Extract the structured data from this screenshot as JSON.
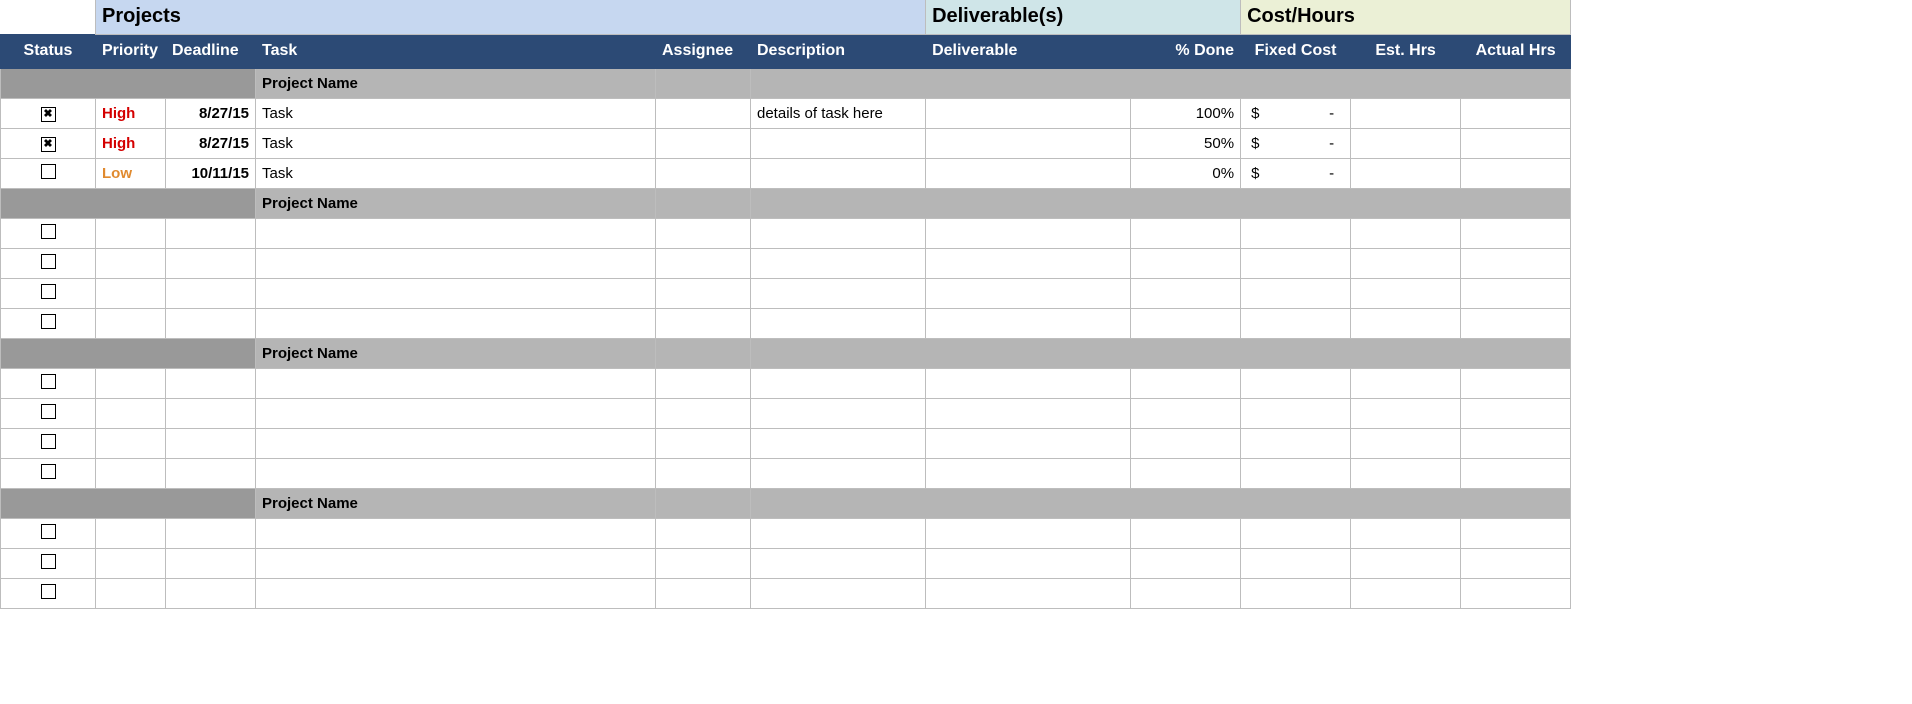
{
  "superheaders": {
    "projects": "Projects",
    "deliverables": "Deliverable(s)",
    "cost": "Cost/Hours"
  },
  "columns": {
    "status": "Status",
    "priority": "Priority",
    "deadline": "Deadline",
    "task": "Task",
    "assignee": "Assignee",
    "description": "Description",
    "deliverable": "Deliverable",
    "pct_done": "% Done",
    "fixed_cost": "Fixed Cost",
    "est_hrs": "Est. Hrs",
    "actual_hrs": "Actual Hrs"
  },
  "groups": [
    {
      "name": "Project Name",
      "tasks": [
        {
          "checked": true,
          "priority": "High",
          "priority_class": "high",
          "deadline": "8/27/15",
          "task": "Task",
          "assignee": "",
          "description": "details of task here",
          "deliverable": "",
          "pct_done": "100%",
          "fixed_cost_sym": "$",
          "fixed_cost_val": "-",
          "est_hrs": "",
          "actual_hrs": ""
        },
        {
          "checked": true,
          "priority": "High",
          "priority_class": "high",
          "deadline": "8/27/15",
          "task": "Task",
          "assignee": "",
          "description": "",
          "deliverable": "",
          "pct_done": "50%",
          "fixed_cost_sym": "$",
          "fixed_cost_val": "-",
          "est_hrs": "",
          "actual_hrs": ""
        },
        {
          "checked": false,
          "priority": "Low",
          "priority_class": "low",
          "deadline": "10/11/15",
          "task": "Task",
          "assignee": "",
          "description": "",
          "deliverable": "",
          "pct_done": "0%",
          "fixed_cost_sym": "$",
          "fixed_cost_val": "-",
          "est_hrs": "",
          "actual_hrs": ""
        }
      ]
    },
    {
      "name": "Project Name",
      "tasks": [
        {
          "checked": false,
          "priority": "",
          "priority_class": "",
          "deadline": "",
          "task": "",
          "assignee": "",
          "description": "",
          "deliverable": "",
          "pct_done": "",
          "fixed_cost_sym": "",
          "fixed_cost_val": "",
          "est_hrs": "",
          "actual_hrs": ""
        },
        {
          "checked": false,
          "priority": "",
          "priority_class": "",
          "deadline": "",
          "task": "",
          "assignee": "",
          "description": "",
          "deliverable": "",
          "pct_done": "",
          "fixed_cost_sym": "",
          "fixed_cost_val": "",
          "est_hrs": "",
          "actual_hrs": ""
        },
        {
          "checked": false,
          "priority": "",
          "priority_class": "",
          "deadline": "",
          "task": "",
          "assignee": "",
          "description": "",
          "deliverable": "",
          "pct_done": "",
          "fixed_cost_sym": "",
          "fixed_cost_val": "",
          "est_hrs": "",
          "actual_hrs": ""
        },
        {
          "checked": false,
          "priority": "",
          "priority_class": "",
          "deadline": "",
          "task": "",
          "assignee": "",
          "description": "",
          "deliverable": "",
          "pct_done": "",
          "fixed_cost_sym": "",
          "fixed_cost_val": "",
          "est_hrs": "",
          "actual_hrs": ""
        }
      ]
    },
    {
      "name": "Project Name",
      "tasks": [
        {
          "checked": false,
          "priority": "",
          "priority_class": "",
          "deadline": "",
          "task": "",
          "assignee": "",
          "description": "",
          "deliverable": "",
          "pct_done": "",
          "fixed_cost_sym": "",
          "fixed_cost_val": "",
          "est_hrs": "",
          "actual_hrs": ""
        },
        {
          "checked": false,
          "priority": "",
          "priority_class": "",
          "deadline": "",
          "task": "",
          "assignee": "",
          "description": "",
          "deliverable": "",
          "pct_done": "",
          "fixed_cost_sym": "",
          "fixed_cost_val": "",
          "est_hrs": "",
          "actual_hrs": ""
        },
        {
          "checked": false,
          "priority": "",
          "priority_class": "",
          "deadline": "",
          "task": "",
          "assignee": "",
          "description": "",
          "deliverable": "",
          "pct_done": "",
          "fixed_cost_sym": "",
          "fixed_cost_val": "",
          "est_hrs": "",
          "actual_hrs": ""
        },
        {
          "checked": false,
          "priority": "",
          "priority_class": "",
          "deadline": "",
          "task": "",
          "assignee": "",
          "description": "",
          "deliverable": "",
          "pct_done": "",
          "fixed_cost_sym": "",
          "fixed_cost_val": "",
          "est_hrs": "",
          "actual_hrs": ""
        }
      ]
    },
    {
      "name": "Project Name",
      "tasks": [
        {
          "checked": false,
          "priority": "",
          "priority_class": "",
          "deadline": "",
          "task": "",
          "assignee": "",
          "description": "",
          "deliverable": "",
          "pct_done": "",
          "fixed_cost_sym": "",
          "fixed_cost_val": "",
          "est_hrs": "",
          "actual_hrs": ""
        },
        {
          "checked": false,
          "priority": "",
          "priority_class": "",
          "deadline": "",
          "task": "",
          "assignee": "",
          "description": "",
          "deliverable": "",
          "pct_done": "",
          "fixed_cost_sym": "",
          "fixed_cost_val": "",
          "est_hrs": "",
          "actual_hrs": ""
        },
        {
          "checked": false,
          "priority": "",
          "priority_class": "",
          "deadline": "",
          "task": "",
          "assignee": "",
          "description": "",
          "deliverable": "",
          "pct_done": "",
          "fixed_cost_sym": "",
          "fixed_cost_val": "",
          "est_hrs": "",
          "actual_hrs": ""
        }
      ]
    }
  ]
}
